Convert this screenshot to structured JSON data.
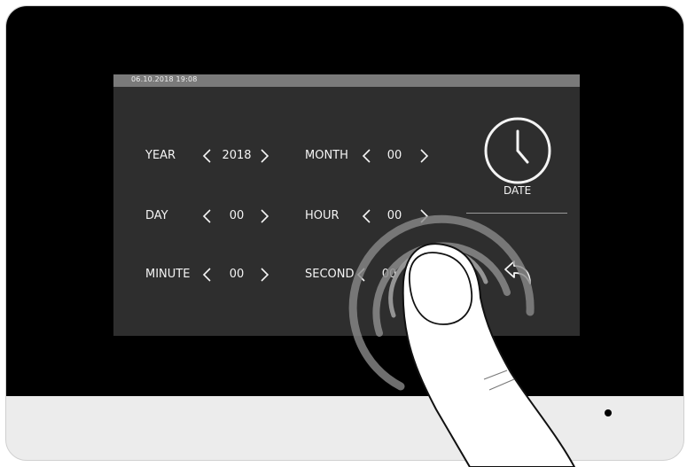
{
  "status_bar": {
    "datetime": "06.10.2018  19:08"
  },
  "fields": [
    {
      "label": "YEAR",
      "value": "2018"
    },
    {
      "label": "MONTH",
      "value": "00"
    },
    {
      "label": "DAY",
      "value": "00"
    },
    {
      "label": "HOUR",
      "value": "00"
    },
    {
      "label": "MINUTE",
      "value": "00"
    },
    {
      "label": "SECOND",
      "value": "00"
    }
  ],
  "side_panel": {
    "date_label": "DATE",
    "clock_icon": "clock-icon",
    "back_icon": "back-arrow-icon"
  }
}
